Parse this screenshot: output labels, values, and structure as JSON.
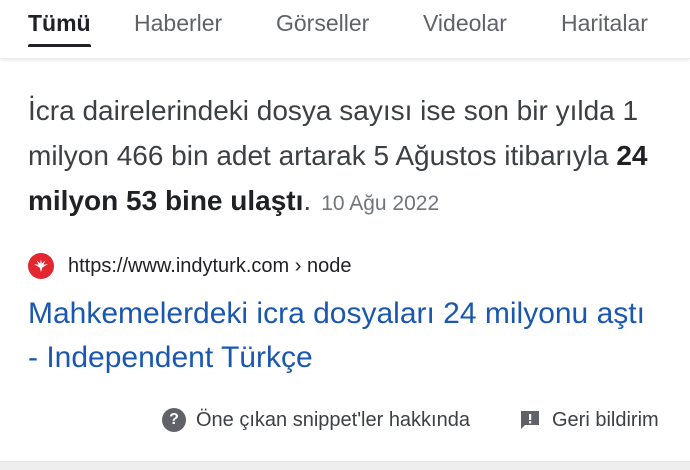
{
  "tabs": [
    {
      "label": "Tümü",
      "active": true
    },
    {
      "label": "Haberler",
      "active": false
    },
    {
      "label": "Görseller",
      "active": false
    },
    {
      "label": "Videolar",
      "active": false
    },
    {
      "label": "Haritalar",
      "active": false
    }
  ],
  "snippet": {
    "text_before_bold": "İcra dairelerindeki dosya sayısı ise son bir yılda 1 milyon 466 bin adet artarak 5 Ağustos itibarıyla ",
    "text_bold": "24 milyon 53 bine ulaştı",
    "text_after_bold": ".",
    "date": "10 Ağu 2022"
  },
  "result": {
    "favicon_icon": "indyturk-favicon-icon",
    "favicon_color": "#e3262f",
    "url": "https://www.indyturk.com › node",
    "title": "Mahkemelerdeki icra dosyaları 24 milyonu aştı - Independent Türkçe",
    "title_color": "#1a57b0"
  },
  "footer": {
    "about_label": "Öne çıkan snippet'ler hakkında",
    "about_icon": "help-icon",
    "feedback_label": "Geri bildirim",
    "feedback_icon": "feedback-icon"
  }
}
